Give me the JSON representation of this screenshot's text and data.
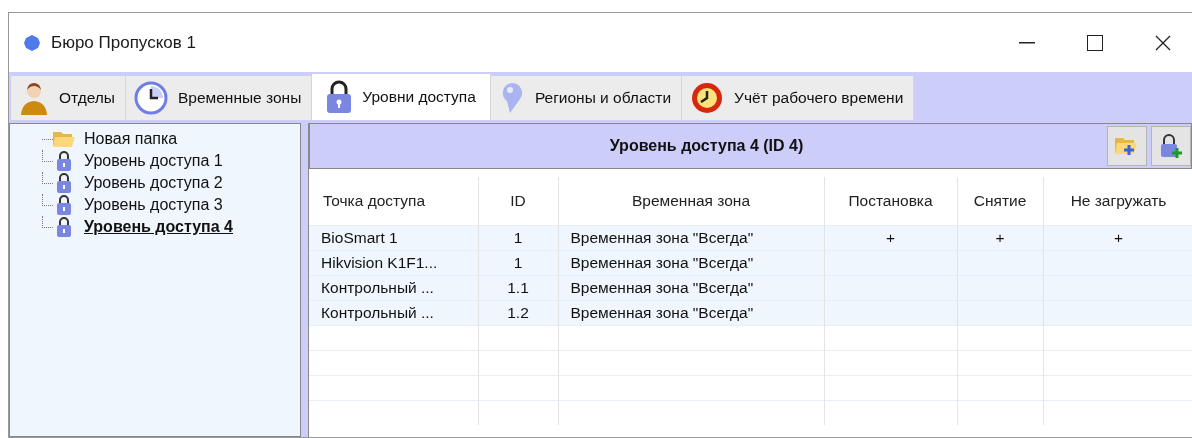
{
  "window": {
    "title": "Бюро Пропусков 1"
  },
  "tabs": [
    {
      "label": "Отделы",
      "selected": false
    },
    {
      "label": "Временные зоны",
      "selected": false
    },
    {
      "label": "Уровни доступа",
      "selected": true
    },
    {
      "label": "Регионы и области",
      "selected": false
    },
    {
      "label": "Учёт рабочего времени",
      "selected": false
    }
  ],
  "tree": {
    "items": [
      {
        "label": "Новая папка",
        "kind": "folder",
        "selected": false
      },
      {
        "label": "Уровень доступа 1",
        "kind": "level",
        "selected": false
      },
      {
        "label": "Уровень доступа 2",
        "kind": "level",
        "selected": false
      },
      {
        "label": "Уровень доступа 3",
        "kind": "level",
        "selected": false
      },
      {
        "label": "Уровень доступа 4",
        "kind": "level",
        "selected": true
      }
    ]
  },
  "panel": {
    "title": "Уровень доступа 4 (ID 4)"
  },
  "table": {
    "columns": [
      "Точка доступа",
      "ID",
      "Временная зона",
      "Постановка",
      "Снятие",
      "Не загружать"
    ],
    "rows": [
      [
        "BioSmart 1",
        "1",
        "Временная зона \"Всегда\"",
        "+",
        "+",
        "+"
      ],
      [
        "Hikvision K1F1...",
        "1",
        "Временная зона \"Всегда\"",
        "",
        "",
        ""
      ],
      [
        "Контрольный ...",
        "1.1",
        "Временная зона \"Всегда\"",
        "",
        "",
        ""
      ],
      [
        "Контрольный ...",
        "1.2",
        "Временная зона \"Всегда\"",
        "",
        "",
        ""
      ]
    ]
  }
}
